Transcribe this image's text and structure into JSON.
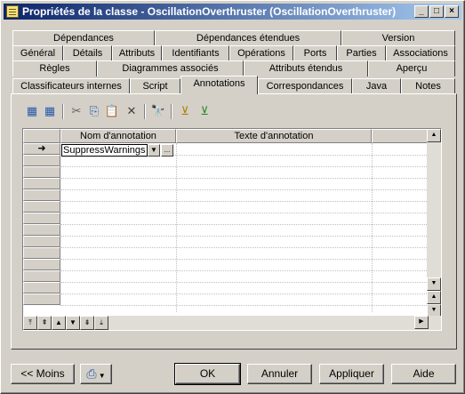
{
  "window": {
    "title": "Propriétés de la classe - OscillationOverthruster (OscillationOverthruster)",
    "controls": [
      "_",
      "□",
      "×"
    ]
  },
  "tabs": {
    "row1": [
      "Dépendances",
      "Dépendances étendues",
      "Version"
    ],
    "row2": [
      "Général",
      "Détails",
      "Attributs",
      "Identifiants",
      "Opérations",
      "Ports",
      "Parties",
      "Associations"
    ],
    "row3": [
      "Règles",
      "Diagrammes associés",
      "Attributs étendus",
      "Aperçu"
    ],
    "row4": [
      "Classificateurs internes",
      "Script",
      "Annotations",
      "Correspondances",
      "Java",
      "Notes"
    ],
    "active": "Annotations"
  },
  "toolbar": {
    "icons": [
      "add-row-icon",
      "insert-row-icon",
      "cut-icon",
      "copy-icon",
      "paste-icon",
      "delete-icon",
      "find-icon",
      "filter-icon",
      "filter-clear-icon"
    ],
    "glyphs": [
      "▦",
      "▦",
      "✂",
      "⎘",
      "📋",
      "✕",
      "🔭",
      "⊻",
      "⊻"
    ]
  },
  "grid": {
    "columns": [
      "Nom d'annotation",
      "Texte d'annotation"
    ],
    "current_row_marker": "➜",
    "rows": [
      {
        "name": "SuppressWarnings",
        "text": ""
      }
    ],
    "edit_dropdown": "▼",
    "edit_ellipsis": "...",
    "nav_glyphs": [
      "⤒",
      "⇞",
      "▲",
      "▼",
      "⇟",
      "⤓"
    ]
  },
  "buttons": {
    "less": "<< Moins",
    "ok": "OK",
    "cancel": "Annuler",
    "apply": "Appliquer",
    "help": "Aide"
  }
}
